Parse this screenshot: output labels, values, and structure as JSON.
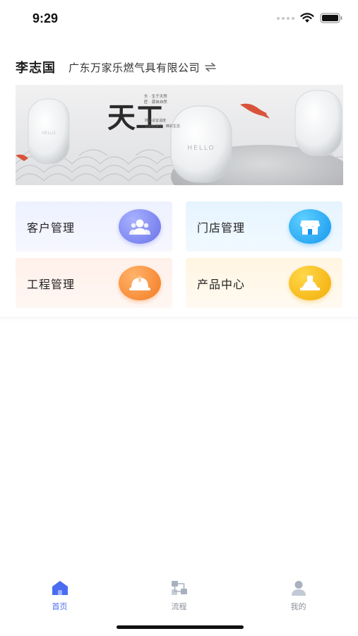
{
  "status_bar": {
    "time": "9:29"
  },
  "header": {
    "user_name": "李志国",
    "company": "广东万家乐燃气具有限公司",
    "swap_icon": "swap-arrows-icon"
  },
  "banner": {
    "headline": "天工",
    "tagline_1": "头 · 生于天然",
    "tagline_2": "匠 · 源自自然",
    "side_text_1": "随心适宜温度",
    "side_text_2": "让从此美学 · 精彩生活",
    "product_text": "HELLO",
    "background_color": "#ebeced"
  },
  "tiles": [
    {
      "label": "客户管理",
      "icon": "customer-people-icon",
      "color": "#6a72e8"
    },
    {
      "label": "门店管理",
      "icon": "storefront-icon",
      "color": "#1596ee"
    },
    {
      "label": "工程管理",
      "icon": "hardhat-icon",
      "color": "#f37b23"
    },
    {
      "label": "产品中心",
      "icon": "range-hood-icon",
      "color": "#f2ab06"
    }
  ],
  "tab_bar": {
    "active_color": "#4a6cf0",
    "inactive_color": "#9aa3b2",
    "tabs": [
      {
        "label": "首页",
        "icon": "home-icon",
        "active": true
      },
      {
        "label": "流程",
        "icon": "flowchart-icon",
        "active": false
      },
      {
        "label": "我的",
        "icon": "profile-icon",
        "active": false
      }
    ]
  }
}
